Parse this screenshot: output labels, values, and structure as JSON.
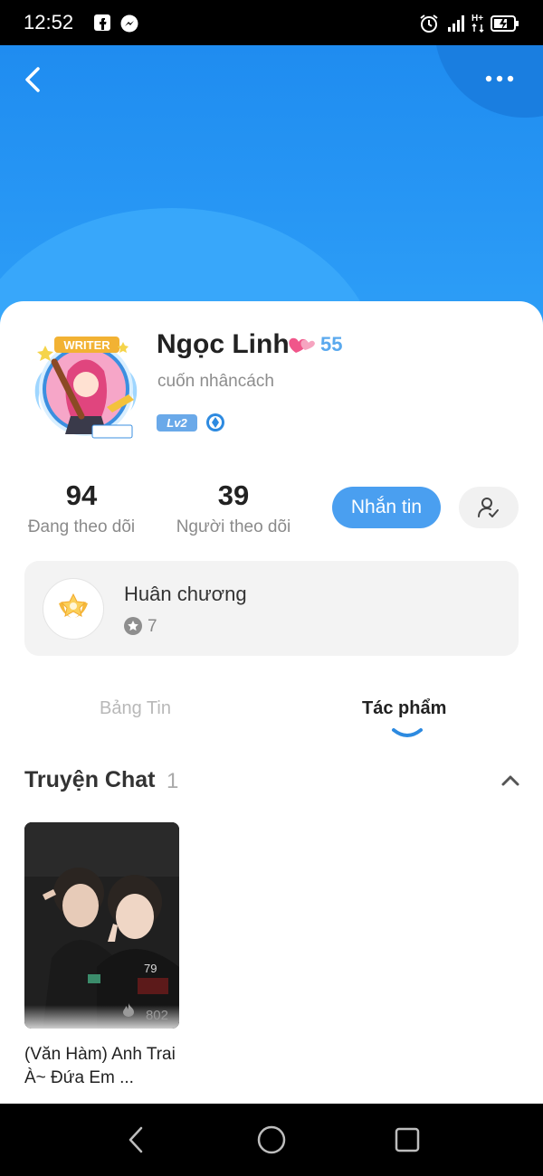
{
  "status_bar": {
    "time": "12:52"
  },
  "profile": {
    "name": "Ngọc Linh",
    "name_count": "55",
    "bio": "cuốn nhâncách",
    "level": "Lv2",
    "avatar_label": "WRITER"
  },
  "stats": {
    "following_count": "94",
    "following_label": "Đang theo dõi",
    "followers_count": "39",
    "followers_label": "Người theo dõi"
  },
  "actions": {
    "message_label": "Nhắn tin"
  },
  "medal": {
    "title": "Huân chương",
    "count": "7"
  },
  "tabs": [
    {
      "label": "Bảng Tin",
      "active": false
    },
    {
      "label": "Tác phẩm",
      "active": true
    }
  ],
  "section": {
    "title": "Truyện Chat",
    "count": "1"
  },
  "stories": [
    {
      "title": "(Văn Hàm) Anh Trai À~ Đứa Em ...",
      "views": "802"
    }
  ],
  "colors": {
    "header_blue": "#1f8cf0",
    "accent_blue": "#4a9ff0",
    "level_badge": "#6aa9e9"
  },
  "icons": [
    "back-icon",
    "more-icon",
    "heart-icon",
    "verified-icon",
    "add-friend-icon",
    "medal-icon",
    "star-icon",
    "chevron-up-icon",
    "fire-icon",
    "nav-back-icon",
    "nav-home-icon",
    "nav-recent-icon"
  ]
}
